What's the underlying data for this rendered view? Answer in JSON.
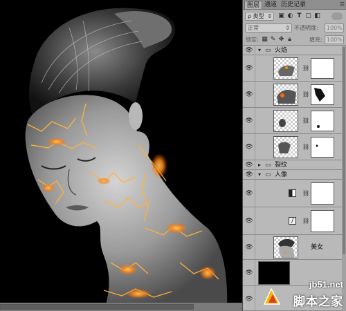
{
  "tabs": [
    {
      "label": "图层",
      "active": true
    },
    {
      "label": "通道",
      "active": false
    },
    {
      "label": "历史记录",
      "active": false
    }
  ],
  "filter": {
    "search_glyph": "ρ",
    "kind_label": "类型"
  },
  "blend": {
    "mode": "正常",
    "opacity_label": "不透明度:",
    "opacity_value": "100%"
  },
  "lock": {
    "label": "锁定:",
    "fill_label": "填充:",
    "fill_value": "100%"
  },
  "groups": [
    {
      "name": "火焰",
      "expanded": true
    },
    {
      "name": "裂纹",
      "expanded": false
    },
    {
      "name": "人像",
      "expanded": true
    }
  ],
  "layers": {
    "portrait_layer_name": "美女"
  },
  "watermark": {
    "url": "jb51.net",
    "cn": "脚本之家"
  },
  "colors": {
    "panel_bg": "#b4b4b4",
    "canvas_bg": "#000000",
    "fire": "#ff9a1e"
  },
  "icons": [
    "eye-icon",
    "folder-icon",
    "link-icon",
    "panel-menu-icon",
    "search-icon"
  ]
}
